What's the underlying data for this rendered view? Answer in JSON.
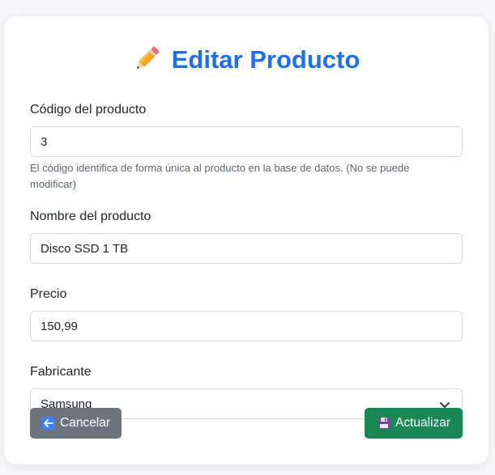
{
  "page": {
    "title": "Editar Producto"
  },
  "form": {
    "codigo": {
      "label": "Código del producto",
      "value": "3",
      "help": "El código identifica de forma única al producto en la base de datos. (No se puede modificar)"
    },
    "nombre": {
      "label": "Nombre del producto",
      "value": "Disco SSD 1 TB"
    },
    "precio": {
      "label": "Precio",
      "value": "150,99"
    },
    "fabricante": {
      "label": "Fabricante",
      "selected": "Samsung"
    }
  },
  "buttons": {
    "cancel_label": "Cancelar",
    "update_label": "Actualizar"
  },
  "colors": {
    "title": "#1f6feb",
    "cancel_bg": "#6c757d",
    "update_bg": "#198754"
  },
  "icons": {
    "title_icon": "pencil-icon",
    "cancel_icon": "left-arrow-icon",
    "update_icon": "floppy-disk-icon",
    "select_icon": "chevron-down-icon"
  }
}
